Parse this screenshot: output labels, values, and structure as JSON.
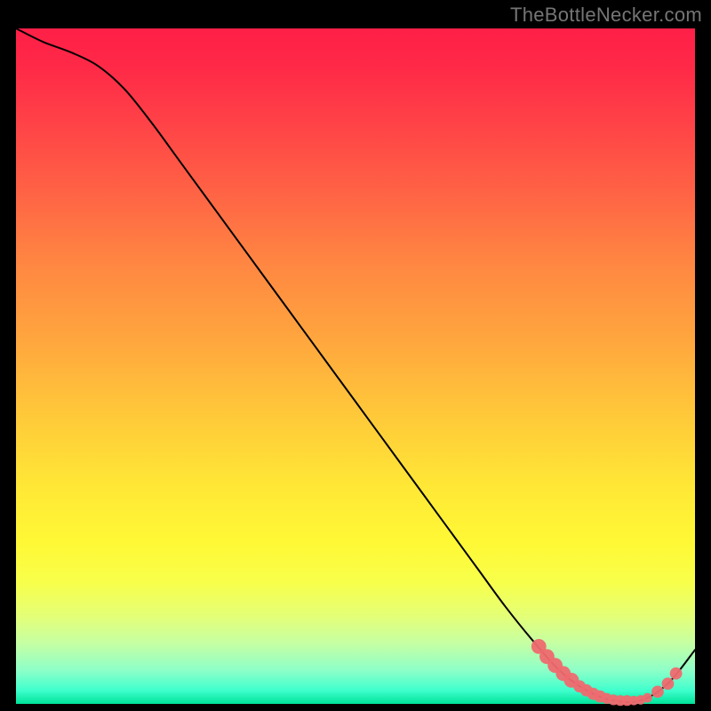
{
  "attribution": "TheBottleNecker.com",
  "chart_data": {
    "type": "line",
    "title": "",
    "xlabel": "",
    "ylabel": "",
    "xlim": [
      0,
      100
    ],
    "ylim": [
      0,
      100
    ],
    "series": [
      {
        "name": "bottleneck-curve",
        "x": [
          0,
          4,
          8,
          12,
          16,
          20,
          24,
          28,
          32,
          36,
          40,
          44,
          48,
          52,
          56,
          60,
          64,
          68,
          72,
          76,
          80,
          84,
          88,
          92,
          96,
          100
        ],
        "y": [
          100,
          98,
          96.5,
          94.5,
          91,
          86,
          80.5,
          75,
          69.5,
          64,
          58.5,
          53,
          47.5,
          42,
          36.5,
          31,
          25.5,
          20,
          14.5,
          9.5,
          5,
          2,
          0.5,
          0.5,
          3,
          8
        ]
      }
    ],
    "markers": {
      "name": "highlighted-region",
      "points": [
        {
          "x": 77.0,
          "y": 8.5,
          "r": 1.1
        },
        {
          "x": 78.2,
          "y": 7.0,
          "r": 1.1
        },
        {
          "x": 79.4,
          "y": 5.7,
          "r": 1.1
        },
        {
          "x": 80.6,
          "y": 4.5,
          "r": 1.1
        },
        {
          "x": 81.8,
          "y": 3.5,
          "r": 1.1
        },
        {
          "x": 83.0,
          "y": 2.6,
          "r": 0.9
        },
        {
          "x": 84.0,
          "y": 2.0,
          "r": 0.9
        },
        {
          "x": 85.0,
          "y": 1.5,
          "r": 0.9
        },
        {
          "x": 86.0,
          "y": 1.1,
          "r": 0.9
        },
        {
          "x": 87.0,
          "y": 0.8,
          "r": 0.8
        },
        {
          "x": 88.0,
          "y": 0.6,
          "r": 0.8
        },
        {
          "x": 89.0,
          "y": 0.5,
          "r": 0.8
        },
        {
          "x": 90.0,
          "y": 0.5,
          "r": 0.8
        },
        {
          "x": 91.0,
          "y": 0.5,
          "r": 0.7
        },
        {
          "x": 92.0,
          "y": 0.6,
          "r": 0.7
        },
        {
          "x": 93.0,
          "y": 0.9,
          "r": 0.7
        },
        {
          "x": 94.5,
          "y": 1.8,
          "r": 0.9
        },
        {
          "x": 96.0,
          "y": 3.0,
          "r": 0.9
        },
        {
          "x": 97.2,
          "y": 4.5,
          "r": 0.9
        }
      ]
    }
  }
}
